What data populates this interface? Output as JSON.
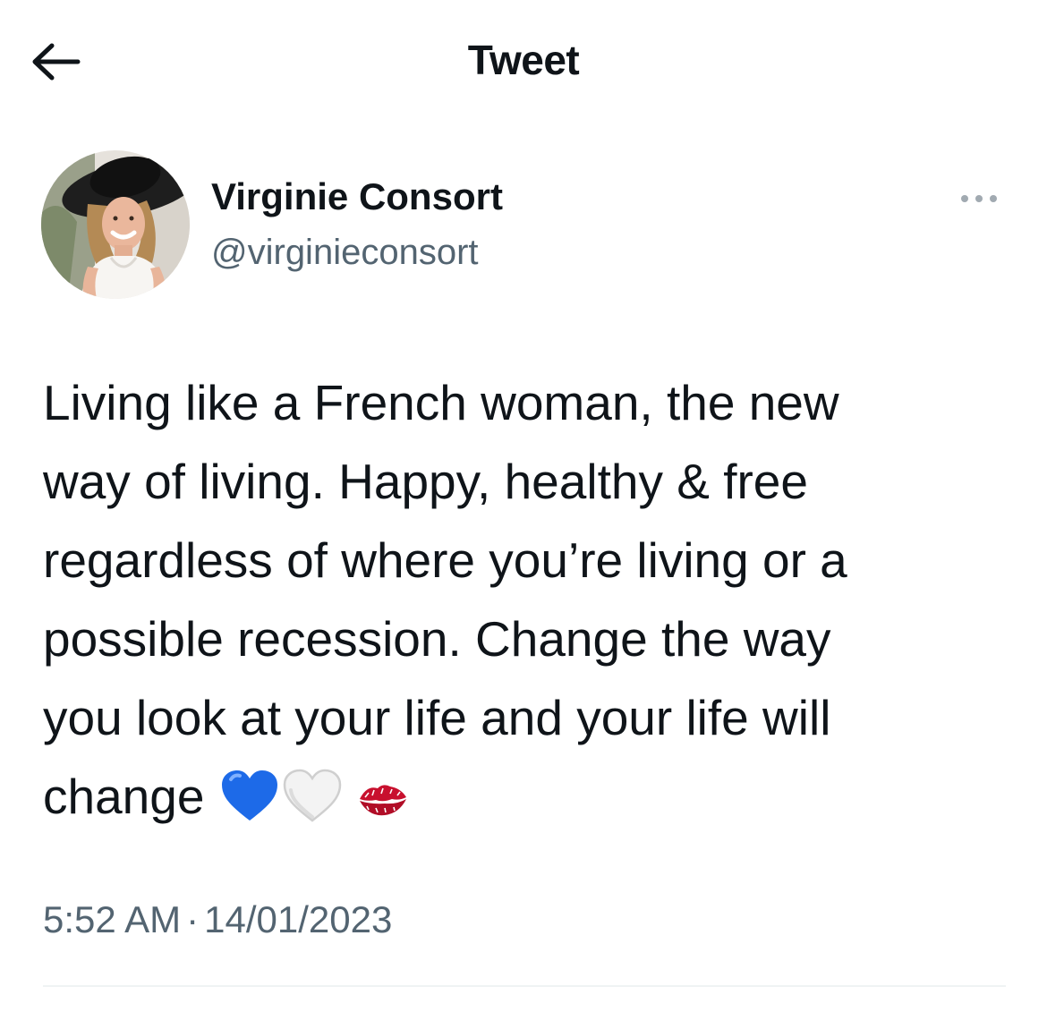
{
  "header": {
    "title": "Tweet",
    "back_icon": "arrow-left-icon"
  },
  "author": {
    "name": "Virginie Consort",
    "handle": "@virginieconsort",
    "avatar_icon": "profile-photo-avatar",
    "more_icon": "more-horizontal-icon"
  },
  "tweet": {
    "lines": [
      "Living like a French woman, the new",
      "way of living. Happy, healthy & free",
      "regardless of where you’re living or a",
      "possible recession. Change the way",
      "you look at your life and your life will",
      "change"
    ],
    "emojis": [
      "blue-heart-emoji",
      "white-heart-emoji",
      "kiss-mark-emoji"
    ]
  },
  "meta": {
    "time": "5:52 AM",
    "separator": "·",
    "date": "14/01/2023"
  },
  "colors": {
    "text_primary": "#0f1419",
    "text_secondary": "#536471",
    "divider": "#eff3f4",
    "blue_heart": "#1d6ae8",
    "kiss_red": "#c8102e"
  }
}
